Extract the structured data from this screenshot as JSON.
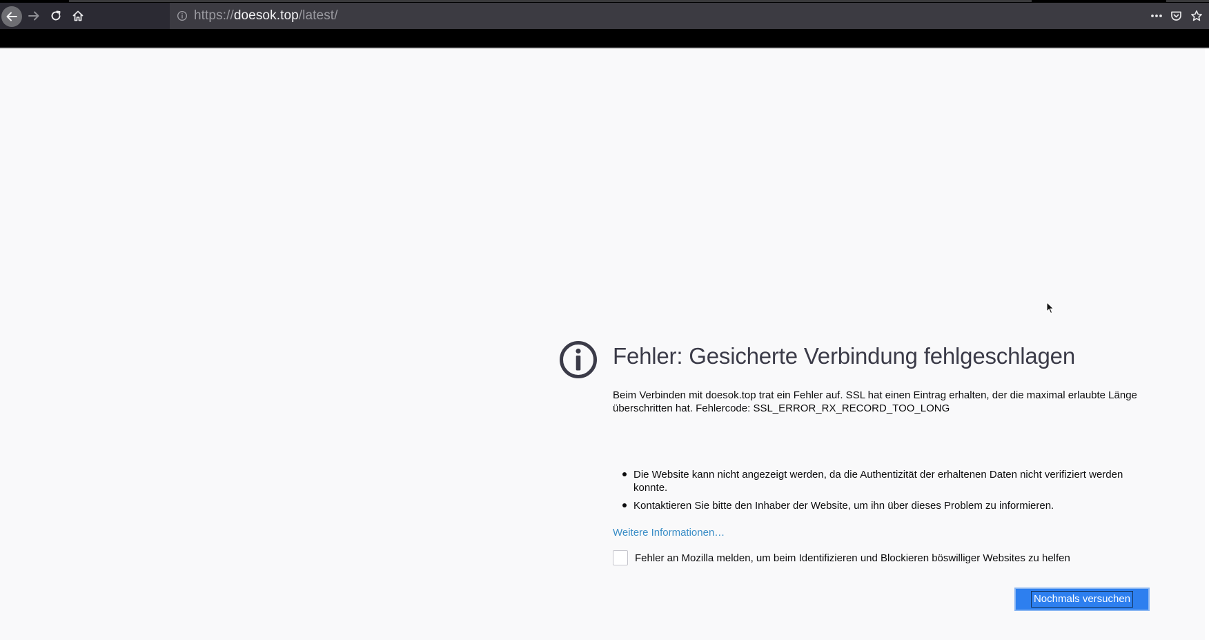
{
  "browser": {
    "url_scheme": "https://",
    "url_host": "doesok.top",
    "url_path": "/latest/",
    "icons": {
      "back": "arrow-left-icon",
      "forward": "arrow-right-icon",
      "reload": "reload-icon",
      "home": "home-icon",
      "site_info": "info-icon",
      "page_actions": "more-icon",
      "pocket": "pocket-icon",
      "bookmark": "star-icon"
    }
  },
  "error_page": {
    "title": "Fehler: Gesicherte Verbindung fehlgeschlagen",
    "description": "Beim Verbinden mit doesok.top trat ein Fehler auf. SSL hat einen Eintrag erhalten, der die maximal erlaubte Länge überschritten hat. Fehlercode: SSL_ERROR_RX_RECORD_TOO_LONG",
    "bullets": [
      "Die Website kann nicht angezeigt werden, da die Authentizität der erhaltenen Daten nicht verifiziert werden konnte.",
      "Kontaktieren Sie bitte den Inhaber der Website, um ihn über dieses Problem zu informieren."
    ],
    "more_info_link": "Weitere Informationen…",
    "report_checkbox_label": "Fehler an Mozilla melden, um beim Identifizieren und Blockieren böswilliger Websites zu helfen",
    "report_checked": false,
    "retry_button": "Nochmals versuchen",
    "icon": "info-circle-icon"
  },
  "colors": {
    "page_background": "#f9f9fa",
    "title": "#3b3b48",
    "link": "#3b8ec7",
    "primary_button": "#2d7fef"
  }
}
